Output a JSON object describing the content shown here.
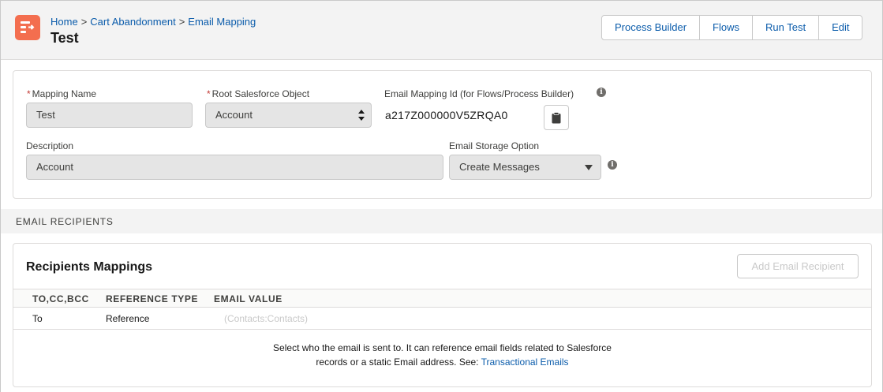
{
  "breadcrumb": {
    "items": [
      "Home",
      "Cart Abandonment",
      "Email Mapping"
    ],
    "separator": ">"
  },
  "page_title": "Test",
  "toolbar": {
    "buttons": [
      "Process Builder",
      "Flows",
      "Run Test",
      "Edit"
    ]
  },
  "form": {
    "mapping_name": {
      "label": "Mapping Name",
      "required_mark": "*",
      "value": "Test"
    },
    "root_object": {
      "label": "Root Salesforce Object",
      "required_mark": "*",
      "value": "Account"
    },
    "mapping_id": {
      "label": "Email Mapping Id (for Flows/Process Builder)",
      "value": "a217Z000000V5ZRQA0"
    },
    "description": {
      "label": "Description",
      "value": "Account"
    },
    "storage_option": {
      "label": "Email Storage Option",
      "value": "Create Messages"
    },
    "info_glyph": "i"
  },
  "section": {
    "title": "EMAIL RECIPIENTS"
  },
  "recipients": {
    "title": "Recipients Mappings",
    "add_button": "Add Email Recipient",
    "columns": [
      "TO,CC,BCC",
      "REFERENCE TYPE",
      "EMAIL VALUE"
    ],
    "rows": [
      {
        "type": "To",
        "reference_type": "Reference",
        "email_value": "(Contacts:Contacts)"
      }
    ],
    "help_line1": "Select who the email is sent to. It can reference email fields related to Salesforce",
    "help_line2": "records or a static Email address. See: ",
    "help_link": "Transactional Emails"
  },
  "icons": {
    "app": "flow-app-icon",
    "info": "info-icon",
    "clipboard": "clipboard-icon",
    "select_arrows": "select-arrows-icon",
    "caret": "chevron-down-icon"
  },
  "colors": {
    "brand_icon": "#f36e4f",
    "link": "#0b5cab",
    "required": "#c23934"
  }
}
